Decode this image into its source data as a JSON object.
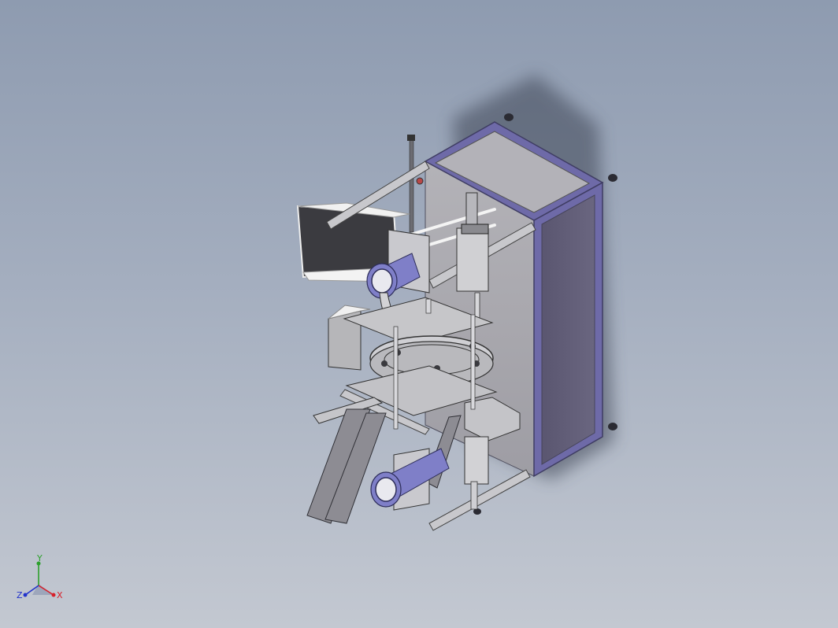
{
  "viewport": {
    "background_top": "#8e9bb0",
    "background_bottom": "#c3c8d1"
  },
  "model": {
    "name": "cad-assembly-machine",
    "frame_color": "#6e6aa8",
    "panel_color": "#b9b7bd",
    "cylinder_color": "#7f7fc8"
  },
  "triad": {
    "x_label": "X",
    "y_label": "Y",
    "z_label": "Z",
    "x_color": "#d8202a",
    "y_color": "#2ca02c",
    "z_color": "#2233cc"
  }
}
